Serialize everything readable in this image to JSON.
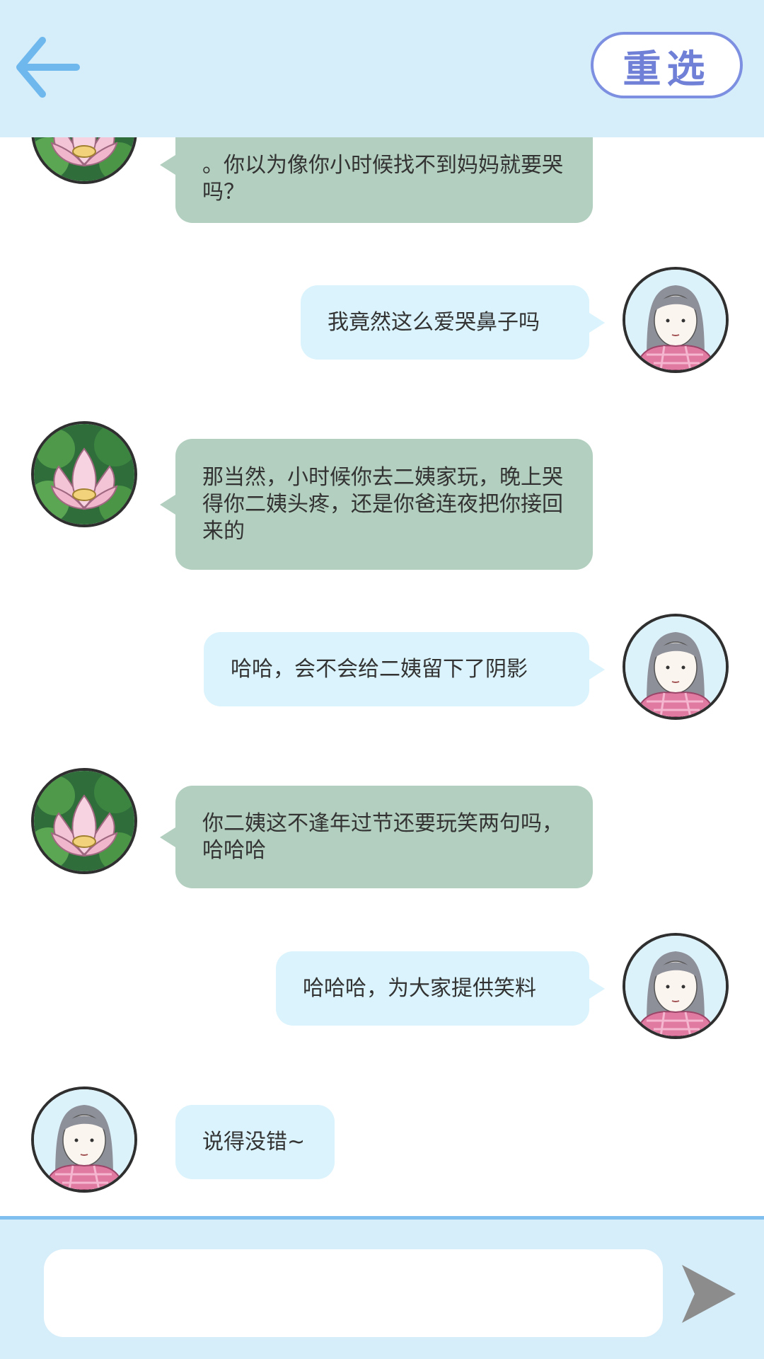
{
  "header": {
    "back_icon": "arrow-left-icon",
    "reselect_label": "重选"
  },
  "messages": [
    {
      "side": "left",
      "avatar": "lotus-avatar",
      "text": "。你以为像你小时候找不到妈妈就要哭吗？"
    },
    {
      "side": "right",
      "avatar": "girl-avatar",
      "text": "我竟然这么爱哭鼻子吗"
    },
    {
      "side": "left",
      "avatar": "lotus-avatar",
      "text": "那当然，小时候你去二姨家玩，晚上哭得你二姨头疼，还是你爸连夜把你接回来的"
    },
    {
      "side": "right",
      "avatar": "girl-avatar",
      "text": "哈哈，会不会给二姨留下了阴影"
    },
    {
      "side": "left",
      "avatar": "lotus-avatar",
      "text": "你二姨这不逢年过节还要玩笑两句吗，哈哈哈"
    },
    {
      "side": "right",
      "avatar": "girl-avatar",
      "text": "哈哈哈，为大家提供笑料"
    },
    {
      "side": "left",
      "avatar": "girl-avatar",
      "text": "说得没错~"
    }
  ],
  "input": {
    "value": "",
    "placeholder": ""
  },
  "send_icon": "send-arrow-icon",
  "colors": {
    "header_bg": "#d6edfa",
    "left_bubble": "#b3cfbf",
    "right_bubble": "#daf3fc",
    "accent": "#7fbff0"
  }
}
